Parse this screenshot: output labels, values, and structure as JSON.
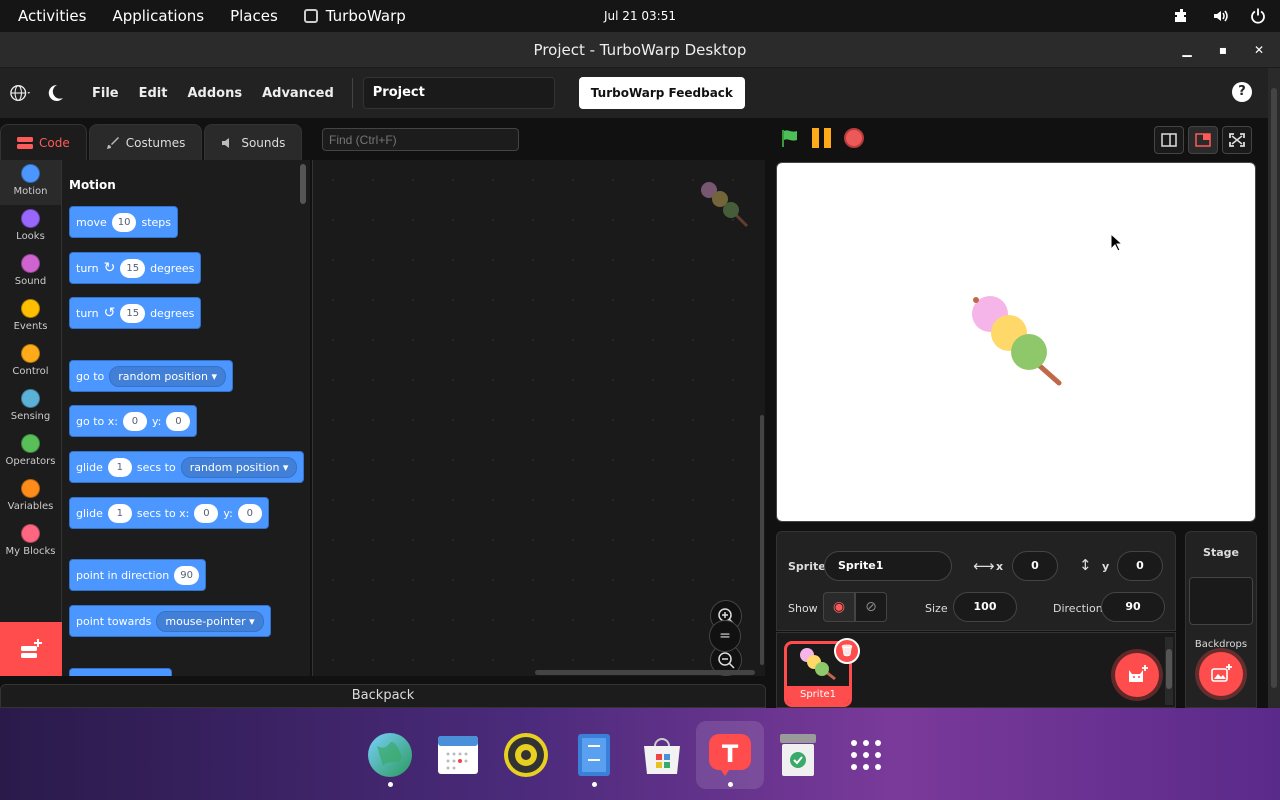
{
  "topbar": {
    "activities": "Activities",
    "applications": "Applications",
    "places": "Places",
    "app": "TurboWarp",
    "clock": "Jul 21  03:51"
  },
  "window": {
    "title": "Project - TurboWarp Desktop"
  },
  "menubar": {
    "file": "File",
    "edit": "Edit",
    "addons": "Addons",
    "advanced": "Advanced",
    "project_name": "Project",
    "feedback": "TurboWarp Feedback",
    "help": "?"
  },
  "tabs": {
    "code": "Code",
    "costumes": "Costumes",
    "sounds": "Sounds"
  },
  "find": {
    "placeholder": "Find (Ctrl+F)"
  },
  "categories": [
    {
      "label": "Motion",
      "color": "#4c97ff"
    },
    {
      "label": "Looks",
      "color": "#9966ff"
    },
    {
      "label": "Sound",
      "color": "#cf63cf"
    },
    {
      "label": "Events",
      "color": "#ffbf00"
    },
    {
      "label": "Control",
      "color": "#ffab19"
    },
    {
      "label": "Sensing",
      "color": "#5cb1d6"
    },
    {
      "label": "Operators",
      "color": "#59c059"
    },
    {
      "label": "Variables",
      "color": "#ff8c1a"
    },
    {
      "label": "My Blocks",
      "color": "#ff6680"
    }
  ],
  "palette": {
    "title": "Motion",
    "move": {
      "a": "move",
      "v": "10",
      "b": "steps"
    },
    "turn_right": {
      "a": "turn",
      "v": "15",
      "b": "degrees"
    },
    "turn_left": {
      "a": "turn",
      "v": "15",
      "b": "degrees"
    },
    "goto": {
      "a": "go to",
      "dd": "random position"
    },
    "gotoxy": {
      "a": "go to x:",
      "x": "0",
      "b": "y:",
      "y": "0"
    },
    "glide": {
      "a": "glide",
      "v": "1",
      "b": "secs to",
      "dd": "random position"
    },
    "glidexy": {
      "a": "glide",
      "v": "1",
      "b": "secs to x:",
      "x": "0",
      "c": "y:",
      "y": "0"
    },
    "point": {
      "a": "point in direction",
      "v": "90"
    },
    "towards": {
      "a": "point towards",
      "dd": "mouse-pointer"
    }
  },
  "zoom": {
    "reset": "="
  },
  "backpack": "Backpack",
  "sprite": {
    "label": "Sprite",
    "name": "Sprite1",
    "x_label": "x",
    "x": "0",
    "y_label": "y",
    "y": "0",
    "show_label": "Show",
    "size_label": "Size",
    "size": "100",
    "direction_label": "Direction",
    "direction": "90"
  },
  "sprites": [
    {
      "name": "Sprite1"
    }
  ],
  "stage_panel": {
    "label": "Stage",
    "backdrops": "Backdrops"
  },
  "dock": [
    "browser",
    "calendar",
    "music",
    "files",
    "software",
    "turbowarp",
    "trash",
    "apps"
  ]
}
